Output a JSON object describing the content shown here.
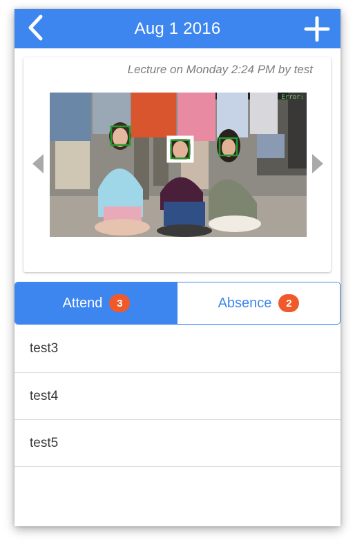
{
  "header": {
    "title": "Aug 1 2016",
    "back_icon": "chevron-left-icon",
    "add_icon": "plus-icon",
    "color": "#3d86f0"
  },
  "lecture": {
    "info": "Lecture on Monday 2:24 PM by test",
    "photo_overlay_text": "Error:"
  },
  "tabs": [
    {
      "label": "Attend",
      "count": "3",
      "active": true
    },
    {
      "label": "Absence",
      "count": "2",
      "active": false
    }
  ],
  "attendees": [
    {
      "name": "test3"
    },
    {
      "name": "test4"
    },
    {
      "name": "test5"
    }
  ],
  "colors": {
    "accent": "#3d86f0",
    "badge": "#f05a2b",
    "face_detect_box": "#1f9b2a",
    "face_selected_box": "#ffffff"
  }
}
